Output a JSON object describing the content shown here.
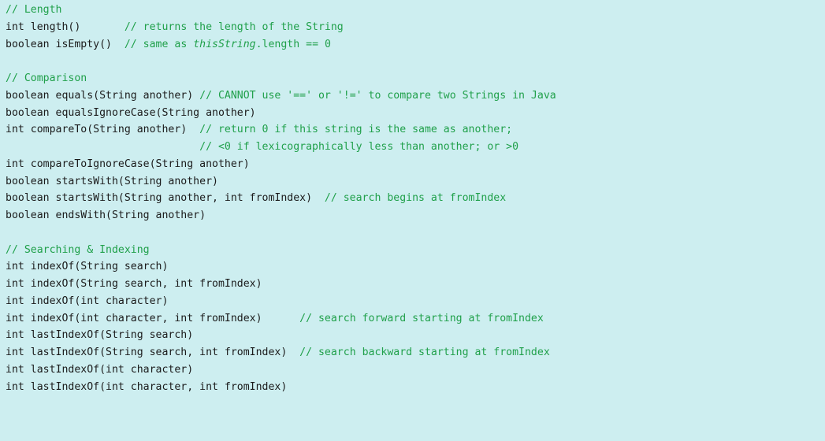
{
  "colors": {
    "background": "#cdeef0",
    "code_text": "#1b1b1b",
    "comment_text": "#20a04a"
  },
  "lines": [
    [
      {
        "t": "// Length",
        "k": "c"
      }
    ],
    [
      {
        "t": "int length()       ",
        "k": "code"
      },
      {
        "t": "// returns the length of the String",
        "k": "c"
      }
    ],
    [
      {
        "t": "boolean isEmpty()  ",
        "k": "code"
      },
      {
        "t": "// same as ",
        "k": "c"
      },
      {
        "t": "thisString",
        "k": "ci"
      },
      {
        "t": ".length == 0",
        "k": "c"
      }
    ],
    [],
    [
      {
        "t": "// Comparison",
        "k": "c"
      }
    ],
    [
      {
        "t": "boolean equals(String another) ",
        "k": "code"
      },
      {
        "t": "// CANNOT use '==' or '!=' to compare two Strings in Java",
        "k": "c"
      }
    ],
    [
      {
        "t": "boolean equalsIgnoreCase(String another)",
        "k": "code"
      }
    ],
    [
      {
        "t": "int compareTo(String another)  ",
        "k": "code"
      },
      {
        "t": "// return 0 if this string is the same as another;",
        "k": "c"
      }
    ],
    [
      {
        "t": "                               ",
        "k": "code"
      },
      {
        "t": "// <0 if lexicographically less than another; or >0",
        "k": "c"
      }
    ],
    [
      {
        "t": "int compareToIgnoreCase(String another)",
        "k": "code"
      }
    ],
    [
      {
        "t": "boolean startsWith(String another)",
        "k": "code"
      }
    ],
    [
      {
        "t": "boolean startsWith(String another, int fromIndex)  ",
        "k": "code"
      },
      {
        "t": "// search begins at fromIndex",
        "k": "c"
      }
    ],
    [
      {
        "t": "boolean endsWith(String another)",
        "k": "code"
      }
    ],
    [],
    [
      {
        "t": "// Searching & Indexing",
        "k": "c"
      }
    ],
    [
      {
        "t": "int indexOf(String search)",
        "k": "code"
      }
    ],
    [
      {
        "t": "int indexOf(String search, int fromIndex)",
        "k": "code"
      }
    ],
    [
      {
        "t": "int indexOf(int character)",
        "k": "code"
      }
    ],
    [
      {
        "t": "int indexOf(int character, int fromIndex)      ",
        "k": "code"
      },
      {
        "t": "// search forward starting at fromIndex",
        "k": "c"
      }
    ],
    [
      {
        "t": "int lastIndexOf(String search)",
        "k": "code"
      }
    ],
    [
      {
        "t": "int lastIndexOf(String search, int fromIndex)  ",
        "k": "code"
      },
      {
        "t": "// search backward starting at fromIndex",
        "k": "c"
      }
    ],
    [
      {
        "t": "int lastIndexOf(int character)",
        "k": "code"
      }
    ],
    [
      {
        "t": "int lastIndexOf(int character, int fromIndex)",
        "k": "code"
      }
    ]
  ]
}
